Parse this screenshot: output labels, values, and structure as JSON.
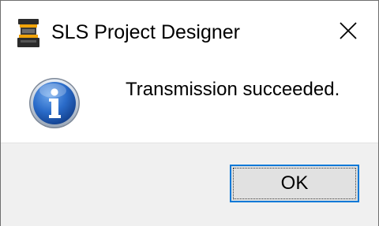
{
  "window": {
    "title": "SLS Project Designer",
    "app_icon": "sls-scanner-icon",
    "close_icon": "close-icon"
  },
  "content": {
    "icon": "info-icon",
    "message": "Transmission succeeded."
  },
  "footer": {
    "ok_label": "OK"
  },
  "colors": {
    "accent": "#0078d7",
    "footer_bg": "#f0f0f0",
    "button_bg": "#e1e1e1",
    "info_blue": "#1f5fb8"
  }
}
